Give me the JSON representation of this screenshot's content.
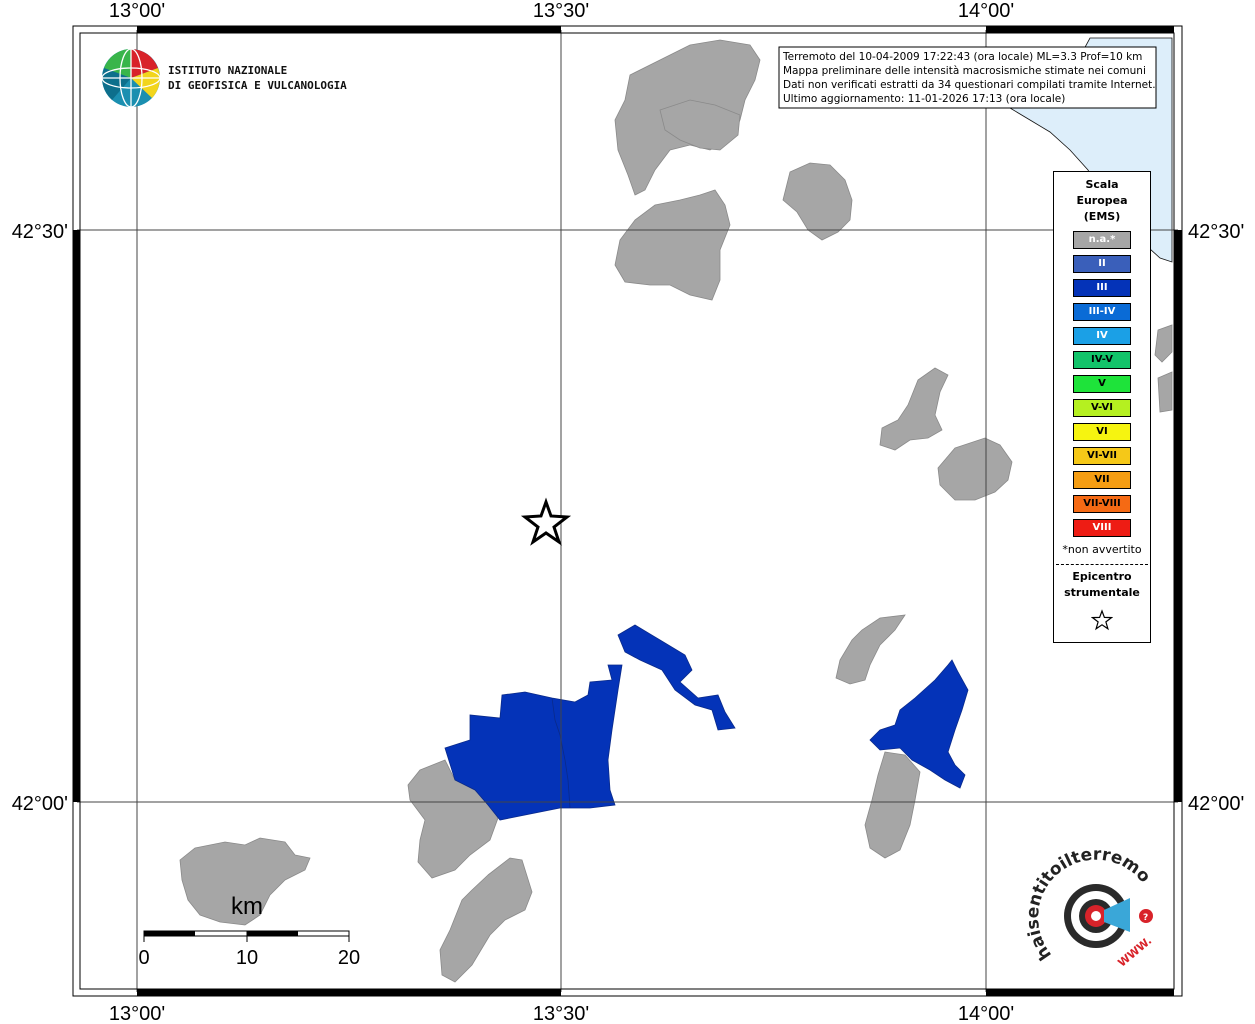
{
  "grid": {
    "top_labels": [
      "13°00'",
      "13°30'",
      "14°00'"
    ],
    "bottom_labels": [
      "13°00'",
      "13°30'",
      "14°00'"
    ],
    "left_labels": [
      "42°30'",
      "42°00'"
    ],
    "right_labels": [
      "42°30'",
      "42°00'"
    ]
  },
  "inset": {
    "lines": [
      "Terremoto del 10-04-2009 17:22:43 (ora locale) ML=3.3 Prof=10 km",
      "Mappa preliminare delle intensità macrosismiche stimate nei comuni",
      "Dati non verificati estratti da 34 questionari compilati tramite Internet.",
      "Ultimo aggiornamento: 11-01-2026 17:13 (ora locale)"
    ]
  },
  "ingv_logo": {
    "line1": "ISTITUTO NAZIONALE",
    "line2": "DI GEOFISICA E VULCANOLOGIA"
  },
  "scalebar": {
    "unit": "km",
    "labels": [
      "0",
      "10",
      "20"
    ]
  },
  "legend": {
    "title_lines": [
      "Scala",
      "Europea",
      "(EMS)"
    ],
    "items": [
      {
        "label": "n.a.*",
        "color": "#a6a6a6",
        "text_color": "#ffffff"
      },
      {
        "label": "II",
        "color": "#3a5fba",
        "text_color": "#ffffff"
      },
      {
        "label": "III",
        "color": "#0433b8",
        "text_color": "#ffffff"
      },
      {
        "label": "III-IV",
        "color": "#0a6bd6",
        "text_color": "#ffffff"
      },
      {
        "label": "IV",
        "color": "#1ba0e6",
        "text_color": "#ffffff"
      },
      {
        "label": "IV-V",
        "color": "#12c46a",
        "text_color": "#000000"
      },
      {
        "label": "V",
        "color": "#1ee33a",
        "text_color": "#000000"
      },
      {
        "label": "V-VI",
        "color": "#b5f020",
        "text_color": "#000000"
      },
      {
        "label": "VI",
        "color": "#f6f410",
        "text_color": "#000000"
      },
      {
        "label": "VI-VII",
        "color": "#f5c818",
        "text_color": "#000000"
      },
      {
        "label": "VII",
        "color": "#f59d12",
        "text_color": "#000000"
      },
      {
        "label": "VII-VIII",
        "color": "#f56a14",
        "text_color": "#000000"
      },
      {
        "label": "VIII",
        "color": "#ee1c14",
        "text_color": "#ffffff"
      }
    ],
    "note": "*non avvertito",
    "epicenter_lines": [
      "Epicentro",
      "strumentale"
    ]
  },
  "hsit_logo": {
    "text": "haisentitoilterremoto.it",
    "www": "WWW."
  },
  "colors": {
    "na": "#a6a6a6",
    "iii": "#0433b8",
    "sea": "#ddeefa",
    "border": "#000000"
  }
}
